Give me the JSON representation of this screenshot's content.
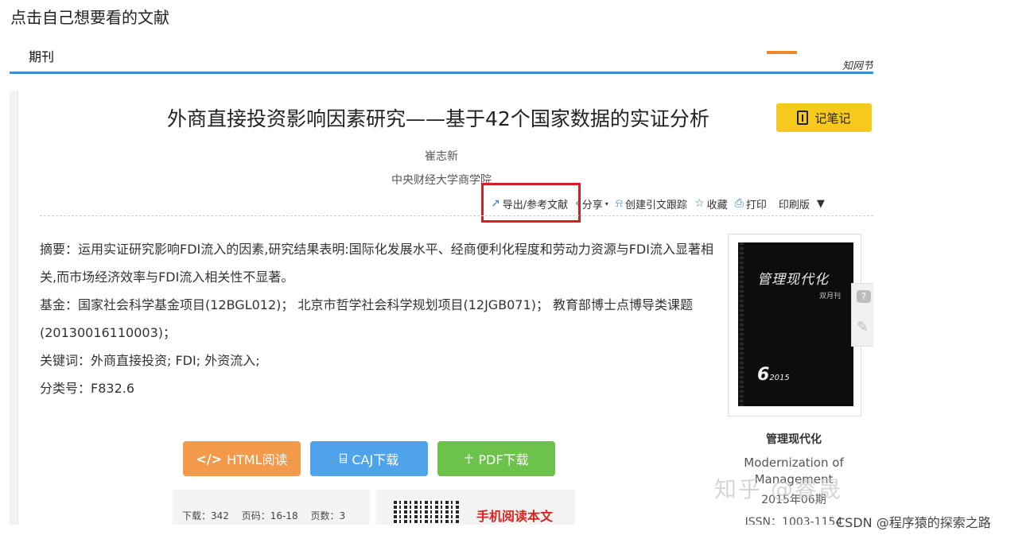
{
  "caption": "点击自己想要看的文献",
  "header": {
    "cut_text": "期刊",
    "logo_text": "知网节"
  },
  "article": {
    "title": "外商直接投资影响因素研究——基于42个国家数据的实证分析",
    "author": "崔志新",
    "organization": "中央财经大学商学院"
  },
  "note_button": {
    "label": "记笔记",
    "icon": "notebook-icon"
  },
  "toolbar": {
    "export": "导出/参考文献",
    "share": "分享",
    "track": "创建引文跟踪",
    "favorite": "收藏",
    "print": "打印",
    "print_version": "印刷版",
    "more": "▼"
  },
  "abstract": {
    "summary": "摘要：运用实证研究影响FDI流入的因素,研究结果表明:国际化发展水平、经商便利化程度和劳动力资源与FDI流入显著相关,而市场经济效率与FDI流入相关性不显著。",
    "fund": "基金：国家社会科学基金项目(12BGL012)； 北京市哲学社会科学规划项目(12JGB071)； 教育部博士点博导类课题(20130016110003)；",
    "keywords": "关键词：外商直接投资; FDI; 外资流入;",
    "classification": "分类号：F832.6"
  },
  "journal": {
    "cover_title": "管理现代化",
    "cover_sub": "双月刊",
    "cover_issue": "6",
    "cover_year": "2015",
    "name": "管理现代化",
    "english": "Modernization of Management",
    "year_issue": "2015年06期",
    "issn": "ISSN：1003-1154"
  },
  "downloads": {
    "html": "HTML阅读",
    "caj": "CAJ下载",
    "pdf": "PDF下载"
  },
  "stats": {
    "downloads": "下载：342",
    "pages": "页码：16-18",
    "page_count": "页数：3"
  },
  "mobile_read": "手机阅读本文",
  "watermarks": {
    "zhihu": "知乎 @睿晟",
    "csdn": "CSDN @程序猿的探索之路"
  },
  "colors": {
    "accent_blue": "#3a8fd6",
    "highlight_red": "#d81e1e",
    "note_yellow": "#f7c91c",
    "html_orange": "#f39a4a",
    "caj_blue": "#4ea3ea",
    "pdf_green": "#6cc24a"
  }
}
